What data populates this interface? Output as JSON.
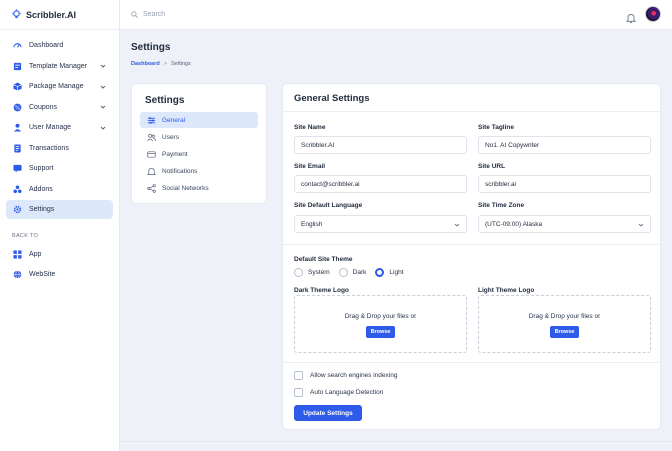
{
  "brand": {
    "name": "Scribbler.AI",
    "icon": "lightbulb-icon"
  },
  "search": {
    "placeholder": "Search",
    "icon": "search-icon"
  },
  "topbar": {
    "bell_icon": "bell-icon",
    "avatar": "user-avatar"
  },
  "sidebar": {
    "items": [
      {
        "label": "Dashboard",
        "icon": "dashboard-icon",
        "has_children": false
      },
      {
        "label": "Template Manager",
        "icon": "template-icon",
        "has_children": true
      },
      {
        "label": "Package Manage",
        "icon": "package-icon",
        "has_children": true
      },
      {
        "label": "Coupons",
        "icon": "coupon-icon",
        "has_children": true
      },
      {
        "label": "User Manage",
        "icon": "user-icon",
        "has_children": true
      },
      {
        "label": "Transactions",
        "icon": "transactions-icon",
        "has_children": false
      },
      {
        "label": "Support",
        "icon": "support-icon",
        "has_children": false
      },
      {
        "label": "Addons",
        "icon": "addons-icon",
        "has_children": false
      },
      {
        "label": "Settings",
        "icon": "settings-icon",
        "has_children": false,
        "active": true
      }
    ],
    "back_to_label": "BACK TO",
    "back_items": [
      {
        "label": "App",
        "icon": "app-grid-icon"
      },
      {
        "label": "WebSite",
        "icon": "globe-icon"
      }
    ]
  },
  "page": {
    "title": "Settings",
    "breadcrumb": {
      "root": "Dashboard",
      "separator": ">",
      "current": "Settings"
    }
  },
  "settings_menu": {
    "title": "Settings",
    "items": [
      {
        "label": "General",
        "icon": "sliders-icon",
        "active": true
      },
      {
        "label": "Users",
        "icon": "users-icon"
      },
      {
        "label": "Payment",
        "icon": "payment-icon"
      },
      {
        "label": "Notifications",
        "icon": "notification-icon"
      },
      {
        "label": "Social Networks",
        "icon": "share-icon"
      }
    ]
  },
  "general": {
    "title": "General Settings",
    "site_name": {
      "label": "Site Name",
      "value": "Scribbler.AI"
    },
    "site_tagline": {
      "label": "Site Tagline",
      "value": "No1. AI Copywriter"
    },
    "site_email": {
      "label": "Site Email",
      "value": "contact@scribbler.ai"
    },
    "site_url": {
      "label": "Site URL",
      "value": "scribbler.ai"
    },
    "default_language": {
      "label": "Site Default Language",
      "value": "English"
    },
    "time_zone": {
      "label": "Site Time Zone",
      "value": "(UTC-09:00) Alaska"
    },
    "theme": {
      "label": "Default Site Theme",
      "options": [
        "System",
        "Dark",
        "Light"
      ],
      "selected": "Light"
    },
    "dark_logo": {
      "label": "Dark Theme Logo",
      "drop_text": "Drag & Drop your files or",
      "browse": "Browse"
    },
    "light_logo": {
      "label": "Light Theme Logo",
      "drop_text": "Drag & Drop your files or",
      "browse": "Browse"
    },
    "allow_indexing": {
      "label": "Allow search engines indexing",
      "checked": false
    },
    "auto_language": {
      "label": "Auto Language Detection",
      "checked": false
    },
    "update_button": "Update Settings"
  },
  "colors": {
    "accent": "#2f5bea",
    "active_bg": "#dde8fb",
    "page_bg": "#eef1f7"
  }
}
